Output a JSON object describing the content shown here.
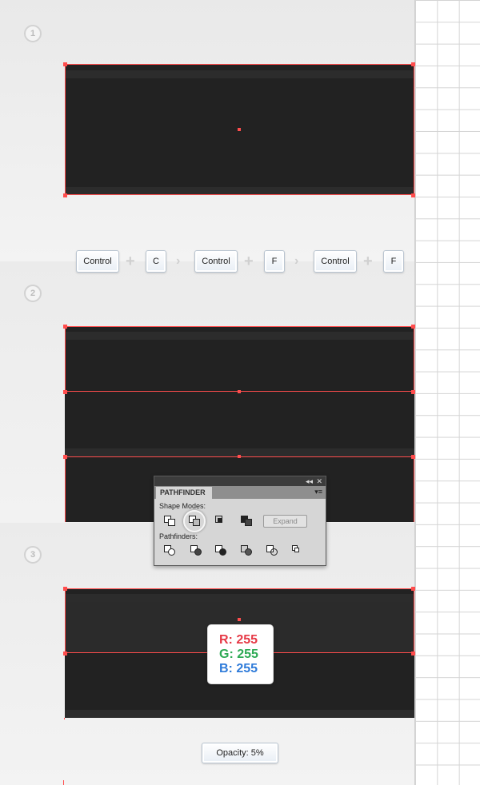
{
  "steps": [
    "1",
    "2",
    "3"
  ],
  "shortcut_keys": {
    "k1": "Control",
    "k2": "C",
    "k3": "Control",
    "k4": "F",
    "k5": "Control",
    "k6": "F",
    "plus_glyph": "+",
    "arrow_glyph": "›"
  },
  "pathfinder": {
    "title": "PATHFINDER",
    "collapse_glyph": "◂◂",
    "close_glyph": "✕",
    "menu_glyph": "▾≡",
    "shape_modes_label": "Shape Modes:",
    "pathfinders_label": "Pathfinders:",
    "expand_label": "Expand",
    "shape_mode_icons": [
      "unite-icon",
      "minus-front-icon",
      "intersect-icon",
      "exclude-icon"
    ],
    "pathfinder_icons": [
      "divide-icon",
      "trim-icon",
      "merge-icon",
      "crop-icon",
      "outline-icon",
      "minus-back-icon"
    ]
  },
  "color": {
    "r": "R: 255",
    "g": "G: 255",
    "b": "B: 255"
  },
  "opacity": {
    "label": "Opacity: 5%"
  }
}
